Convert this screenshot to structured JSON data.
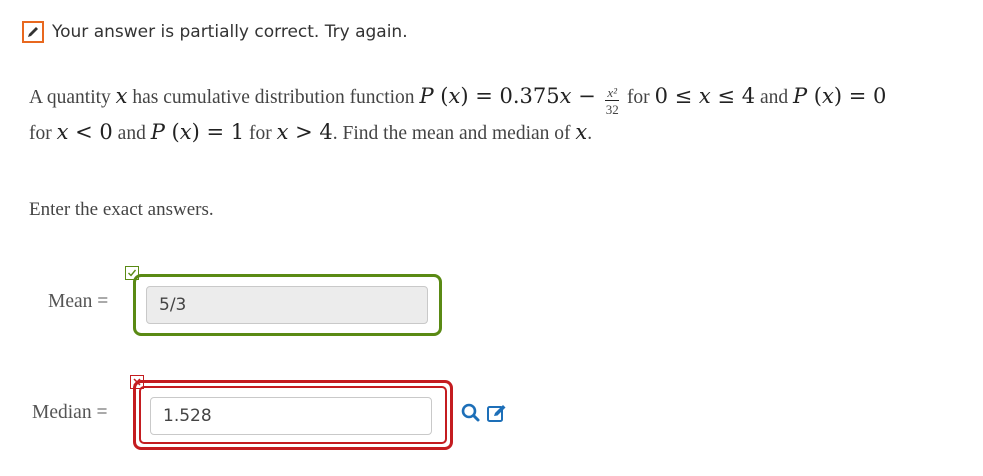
{
  "banner": {
    "icon": "pencil-edit-icon",
    "text": "Your answer is partially correct.  Try again.",
    "accent_color": "#e8681f"
  },
  "question": {
    "line1": {
      "t1": "A quantity ",
      "var_x": "x",
      "t2": " has cumulative distribution function ",
      "P": "P",
      "lparen": "(",
      "rparen": ")",
      "eq": " = ",
      "coef": "0.375",
      "minus": " − ",
      "frac_num": "x²",
      "frac_den": "32",
      "t3": " for ",
      "zero": "0",
      "le": " ≤ ",
      "four": "4",
      "t4": " and ",
      "zero2": "0"
    },
    "line2": {
      "t1": "for ",
      "lt": " < ",
      "zero": "0",
      "t2": " and ",
      "one": "1",
      "t3": " for ",
      "gt": " > ",
      "four": "4",
      "t4": ". Find the mean and median of ",
      "t5": "."
    }
  },
  "instruction": "Enter the exact answers.",
  "mean": {
    "label": "Mean =",
    "value": "5/3",
    "status": "correct",
    "status_color": "#5a8a14",
    "status_icon": "checkmark-icon"
  },
  "median": {
    "label": "Median =",
    "value": "1.528",
    "status": "incorrect",
    "status_color": "#c41c20",
    "status_icon": "cross-icon"
  },
  "tools": {
    "search_icon": "magnifier-icon",
    "edit_icon": "pencil-edit-icon",
    "color": "#1d6fb8"
  }
}
